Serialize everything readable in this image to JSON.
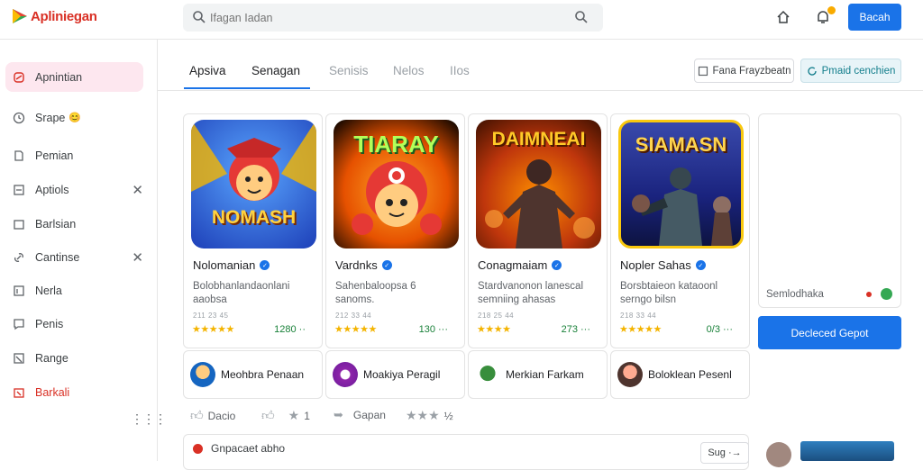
{
  "app": {
    "title": "Apliniegan"
  },
  "search": {
    "placeholder": "Ifagan Iadan"
  },
  "header": {
    "primary_button": "Bacah"
  },
  "sidebar": {
    "items": [
      {
        "label": "Apnintian",
        "icon": "phone-icon"
      },
      {
        "label": "Srape",
        "icon": "clock-icon",
        "emoji": "😊"
      },
      {
        "label": "Pemian",
        "icon": "file-icon"
      },
      {
        "label": "Aptiols",
        "icon": "square-icon",
        "closable": true
      },
      {
        "label": "Barlsian",
        "icon": "folder-icon"
      },
      {
        "label": "Cantinse",
        "icon": "link-icon",
        "closable": true
      },
      {
        "label": "Nerla",
        "icon": "doc-icon"
      },
      {
        "label": "Penis",
        "icon": "chat-icon"
      },
      {
        "label": "Range",
        "icon": "cart-icon"
      },
      {
        "label": "Barkali",
        "icon": "calendar-icon"
      }
    ]
  },
  "tabs": [
    {
      "label": "Apsiva"
    },
    {
      "label": "Senagan"
    },
    {
      "label": "Senisis"
    },
    {
      "label": "Nelos"
    },
    {
      "label": "IIos"
    }
  ],
  "toolbar": {
    "filter_label": "Fana Frayzbeatn",
    "refresh_label": "Pmaid cenchien"
  },
  "cards": [
    {
      "name": "Nolomanian",
      "title_art": "NOMASH",
      "desc": "Bolobhanlandaonlani aaobsa",
      "meta": "211 23 45",
      "stars": "★★★★★",
      "count": "1280 ··"
    },
    {
      "name": "Vardnks",
      "title_art": "TIARAY",
      "desc": "Sahenbaloopsa 6 sanoms.",
      "meta": "212 33 44",
      "stars": "★★★★★",
      "count": "130 ···"
    },
    {
      "name": "Conagmaiam",
      "title_art": "DAIMNEAI",
      "desc": "Stardvanonon lanescal semniing ahasas",
      "meta": "218 25 44",
      "stars": "★★★★",
      "count": "273 ···"
    },
    {
      "name": "Nopler Sahas",
      "title_art": "SIAMASN",
      "desc": "Borsbtaieon kataoonl serngo bilsn",
      "meta": "218 33 44",
      "stars": "★★★★★",
      "count": "0/3 ···"
    }
  ],
  "side_card": {
    "label": "Semlodhaka"
  },
  "side_button": {
    "label": "Decleced Gepot"
  },
  "developers": [
    {
      "name": "Meohbra Penaan"
    },
    {
      "name": "Moakiya Peragil"
    },
    {
      "name": "Merkian Farkam"
    },
    {
      "name": "Boloklean Pesenl"
    }
  ],
  "actions": {
    "like_label": "Dacio",
    "rate_value": "1",
    "share_label": "Gapan",
    "rating_stars": "★★★",
    "rating_suffix": "½"
  },
  "bottom": {
    "title": "Gnpacaet abho",
    "button": "Sug ·→"
  },
  "colors": {
    "accent": "#1a73e8",
    "brand": "#d93025",
    "active_bg": "#fde7ef",
    "star": "#f4b400",
    "count": "#188038"
  }
}
